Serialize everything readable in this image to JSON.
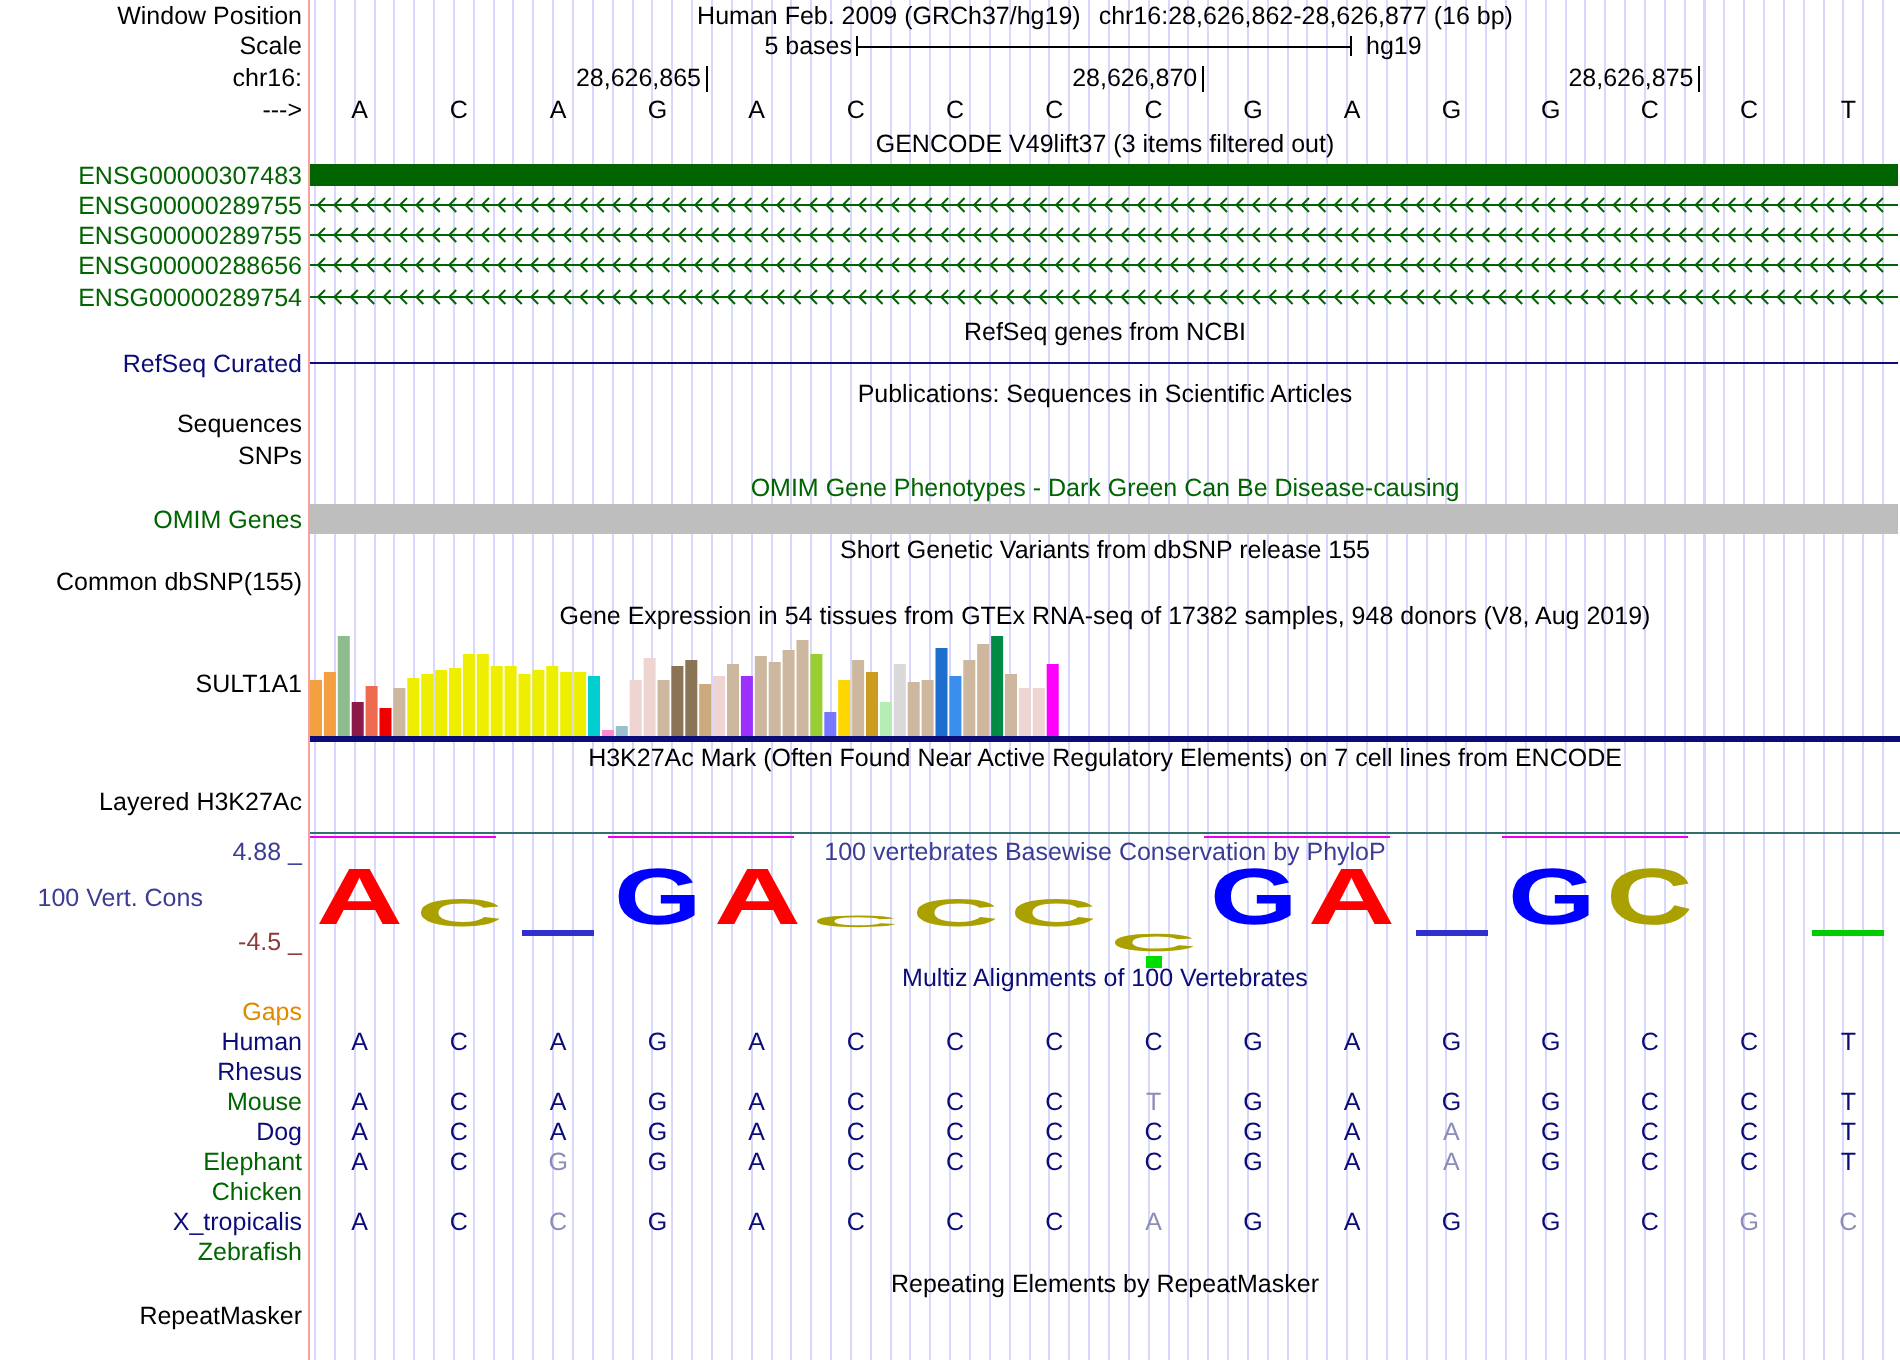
{
  "header": {
    "label": "Window Position",
    "assembly": "Human Feb. 2009 (GRCh37/hg19)",
    "position": "chr16:28,626,862-28,626,877 (16 bp)"
  },
  "scale": {
    "label": "Scale",
    "length": "5 bases",
    "assembly": "hg19"
  },
  "ruler": {
    "label": "chr16:",
    "ticks": [
      {
        "label": "28,626,865"
      },
      {
        "label": "28,626,870"
      },
      {
        "label": "28,626,875"
      }
    ]
  },
  "sequence": {
    "label": "--->",
    "bases": [
      "A",
      "C",
      "A",
      "G",
      "A",
      "C",
      "C",
      "C",
      "C",
      "G",
      "A",
      "G",
      "G",
      "C",
      "C",
      "T"
    ]
  },
  "tracks": [
    {
      "kind": "genes",
      "title": "GENCODE V49lift37 (3 items filtered out)",
      "color": "#006400",
      "items": [
        {
          "name": "ENSG00000307483",
          "kind": "block"
        },
        {
          "name": "ENSG00000289755",
          "kind": "arrows"
        },
        {
          "name": "ENSG00000289755",
          "kind": "arrows"
        },
        {
          "name": "ENSG00000288656",
          "kind": "arrows"
        },
        {
          "name": "ENSG00000289754",
          "kind": "arrows"
        }
      ]
    },
    {
      "kind": "line",
      "title": "RefSeq genes from NCBI",
      "color": "#0c0c78",
      "label": "RefSeq Curated"
    },
    {
      "kind": "empty",
      "title": "Publications: Sequences in Scientific Articles",
      "color": "#000000",
      "labels": [
        "Sequences",
        "SNPs"
      ]
    },
    {
      "kind": "bar",
      "title": "OMIM Gene Phenotypes - Dark Green Can Be Disease-causing",
      "color": "#006400",
      "label": "OMIM Genes"
    },
    {
      "kind": "empty",
      "title": "Short Genetic Variants from dbSNP release 155",
      "color": "#000000",
      "labels": [
        "Common dbSNP(155)"
      ]
    },
    {
      "kind": "expression",
      "title": "Gene Expression in 54 tissues from GTEx RNA-seq of 17382 samples, 948 donors (V8, Aug 2019)",
      "color": "#000000",
      "label": "SULT1A1"
    },
    {
      "kind": "ruled",
      "title": "H3K27Ac Mark (Often Found Near Active Regulatory Elements) on 7 cell lines from ENCODE",
      "color": "#000000",
      "labels": [
        "Layered H3K27Ac"
      ]
    },
    {
      "kind": "conservation",
      "title": "100 vertebrates Basewise Conservation by PhyloP",
      "color": "#3c3c96",
      "label": "100 Vert. Cons",
      "max": "4.88 _",
      "min": "-4.5 _",
      "logo": [
        {
          "kind": "up",
          "letter": "A",
          "color": "#ff0000"
        },
        {
          "kind": "up",
          "letter": "C",
          "color": "#aaa000"
        },
        {
          "kind": "mark",
          "color": "#3030d0"
        },
        {
          "kind": "up",
          "letter": "G",
          "color": "#0000ff"
        },
        {
          "kind": "up",
          "letter": "A",
          "color": "#ff0000"
        },
        {
          "kind": "up",
          "letter": "C",
          "color": "#aaa000"
        },
        {
          "kind": "up",
          "letter": "C",
          "color": "#aaa000"
        },
        {
          "kind": "up",
          "letter": "C",
          "color": "#aaa000"
        },
        {
          "kind": "down",
          "letter": "C",
          "color": "#aaa000"
        },
        {
          "kind": "up",
          "letter": "G",
          "color": "#0000ff"
        },
        {
          "kind": "up",
          "letter": "A",
          "color": "#ff0000"
        },
        {
          "kind": "mark",
          "color": "#3030d0"
        },
        {
          "kind": "up",
          "letter": "G",
          "color": "#0000ff"
        },
        {
          "kind": "up",
          "letter": "C",
          "color": "#aaa000"
        },
        {
          "kind": "blank"
        },
        {
          "kind": "mark",
          "color": "#00cc00"
        }
      ]
    },
    {
      "kind": "alignment",
      "title": "Multiz Alignments of 100 Vertebrates",
      "color": "#0c0c78",
      "gaps": {
        "label": "Gaps",
        "color": "#e08a00"
      },
      "species": [
        {
          "name": "Human",
          "color": "#0c0c78",
          "bases": [
            {
              "b": "A",
              "dim": false
            },
            {
              "b": "C",
              "dim": false
            },
            {
              "b": "A",
              "dim": false
            },
            {
              "b": "G",
              "dim": false
            },
            {
              "b": "A",
              "dim": false
            },
            {
              "b": "C",
              "dim": false
            },
            {
              "b": "C",
              "dim": false
            },
            {
              "b": "C",
              "dim": false
            },
            {
              "b": "C",
              "dim": false
            },
            {
              "b": "G",
              "dim": false
            },
            {
              "b": "A",
              "dim": false
            },
            {
              "b": "G",
              "dim": false
            },
            {
              "b": "G",
              "dim": false
            },
            {
              "b": "C",
              "dim": false
            },
            {
              "b": "C",
              "dim": false
            },
            {
              "b": "T",
              "dim": false
            }
          ]
        },
        {
          "name": "Rhesus",
          "color": "#0c0c78"
        },
        {
          "name": "Mouse",
          "color": "#006400",
          "bases": [
            {
              "b": "A",
              "dim": false
            },
            {
              "b": "C",
              "dim": false
            },
            {
              "b": "A",
              "dim": false
            },
            {
              "b": "G",
              "dim": false
            },
            {
              "b": "A",
              "dim": false
            },
            {
              "b": "C",
              "dim": false
            },
            {
              "b": "C",
              "dim": false
            },
            {
              "b": "C",
              "dim": false
            },
            {
              "b": "T",
              "dim": true
            },
            {
              "b": "G",
              "dim": false
            },
            {
              "b": "A",
              "dim": false
            },
            {
              "b": "G",
              "dim": false
            },
            {
              "b": "G",
              "dim": false
            },
            {
              "b": "C",
              "dim": false
            },
            {
              "b": "C",
              "dim": false
            },
            {
              "b": "T",
              "dim": false
            }
          ]
        },
        {
          "name": "Dog",
          "color": "#0c0c78",
          "bases": [
            {
              "b": "A",
              "dim": false
            },
            {
              "b": "C",
              "dim": false
            },
            {
              "b": "A",
              "dim": false
            },
            {
              "b": "G",
              "dim": false
            },
            {
              "b": "A",
              "dim": false
            },
            {
              "b": "C",
              "dim": false
            },
            {
              "b": "C",
              "dim": false
            },
            {
              "b": "C",
              "dim": false
            },
            {
              "b": "C",
              "dim": false
            },
            {
              "b": "G",
              "dim": false
            },
            {
              "b": "A",
              "dim": false
            },
            {
              "b": "A",
              "dim": true
            },
            {
              "b": "G",
              "dim": false
            },
            {
              "b": "C",
              "dim": false
            },
            {
              "b": "C",
              "dim": false
            },
            {
              "b": "T",
              "dim": false
            }
          ]
        },
        {
          "name": "Elephant",
          "color": "#006400",
          "bases": [
            {
              "b": "A",
              "dim": false
            },
            {
              "b": "C",
              "dim": false
            },
            {
              "b": "G",
              "dim": true
            },
            {
              "b": "G",
              "dim": false
            },
            {
              "b": "A",
              "dim": false
            },
            {
              "b": "C",
              "dim": false
            },
            {
              "b": "C",
              "dim": false
            },
            {
              "b": "C",
              "dim": false
            },
            {
              "b": "C",
              "dim": false
            },
            {
              "b": "G",
              "dim": false
            },
            {
              "b": "A",
              "dim": false
            },
            {
              "b": "A",
              "dim": true
            },
            {
              "b": "G",
              "dim": false
            },
            {
              "b": "C",
              "dim": false
            },
            {
              "b": "C",
              "dim": false
            },
            {
              "b": "T",
              "dim": false
            }
          ]
        },
        {
          "name": "Chicken",
          "color": "#006400"
        },
        {
          "name": "X_tropicalis",
          "color": "#0c0c78",
          "bases": [
            {
              "b": "A",
              "dim": false
            },
            {
              "b": "C",
              "dim": false
            },
            {
              "b": "C",
              "dim": true
            },
            {
              "b": "G",
              "dim": false
            },
            {
              "b": "A",
              "dim": false
            },
            {
              "b": "C",
              "dim": false
            },
            {
              "b": "C",
              "dim": false
            },
            {
              "b": "C",
              "dim": false
            },
            {
              "b": "A",
              "dim": true
            },
            {
              "b": "G",
              "dim": false
            },
            {
              "b": "A",
              "dim": false
            },
            {
              "b": "G",
              "dim": false
            },
            {
              "b": "G",
              "dim": false
            },
            {
              "b": "C",
              "dim": false
            },
            {
              "b": "G",
              "dim": true
            },
            {
              "b": "C",
              "dim": true
            }
          ]
        },
        {
          "name": "Zebrafish",
          "color": "#006400"
        }
      ]
    },
    {
      "kind": "empty",
      "title": "Repeating Elements by RepeatMasker",
      "color": "#000000",
      "labels": [
        "RepeatMasker"
      ]
    }
  ]
}
